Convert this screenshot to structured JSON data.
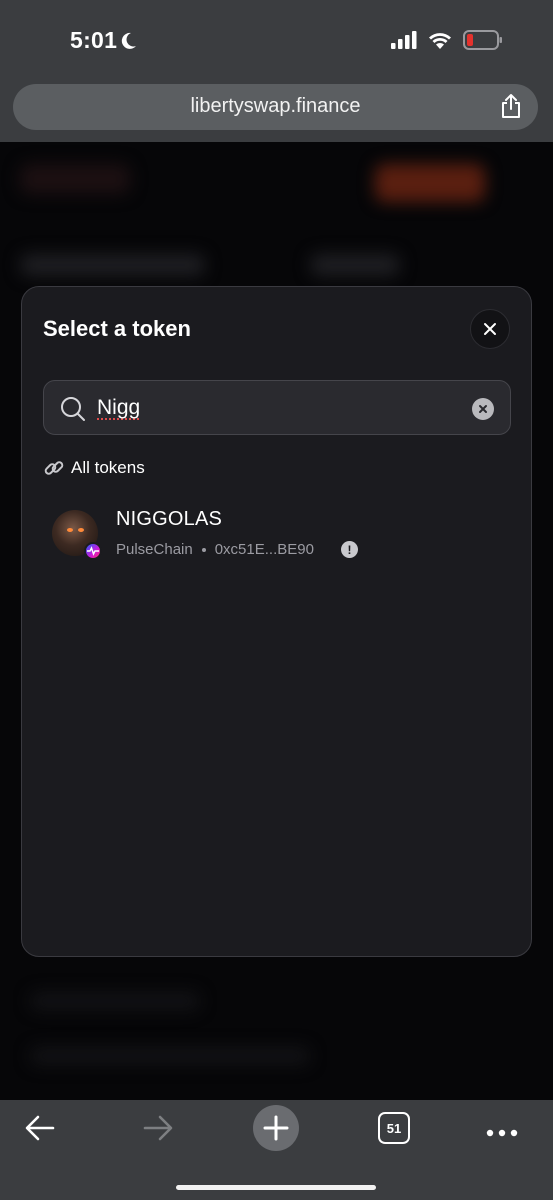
{
  "status": {
    "time": "5:01",
    "battery_color": "#e5322d"
  },
  "browser": {
    "url": "libertyswap.finance",
    "tabs_count": "51"
  },
  "modal": {
    "title": "Select a token",
    "search_value_prefix": "Nigg",
    "section_label": "All tokens",
    "tokens": [
      {
        "symbol": "NIGGOLAS",
        "chain": "PulseChain",
        "address": "0xc51E...BE90",
        "warning": "!"
      }
    ]
  },
  "colors": {
    "modal_bg": "#1b1b1f",
    "toolbar_bg": "#3b3d40",
    "accent": "#ff4d2e"
  }
}
